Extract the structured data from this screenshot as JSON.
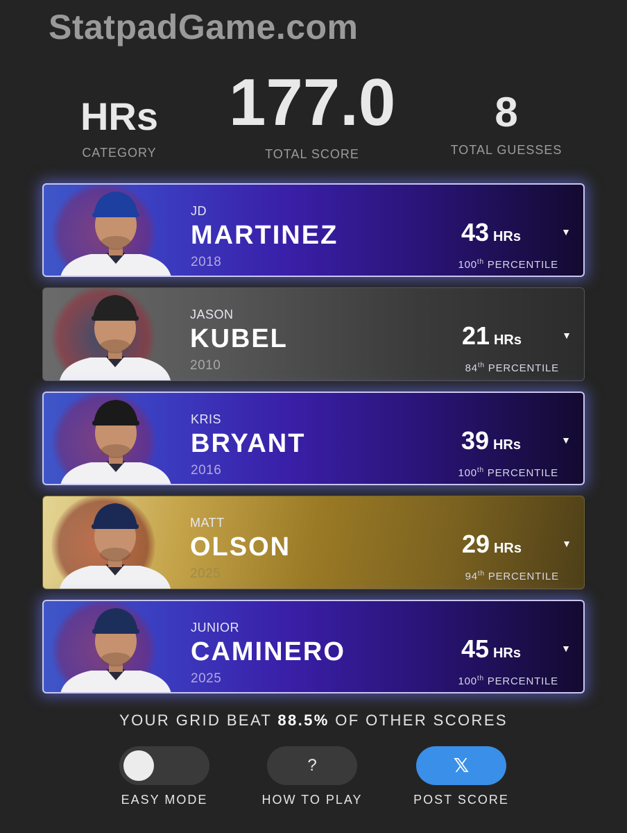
{
  "header": {
    "site_title": "StatpadGame.com"
  },
  "summary": {
    "category_value": "HRs",
    "category_label": "CATEGORY",
    "score_value": "177.0",
    "score_label": "TOTAL SCORE",
    "guesses_value": "8",
    "guesses_label": "TOTAL GUESSES"
  },
  "players": [
    {
      "first": "JD",
      "last": "MARTINEZ",
      "year": "2018",
      "hrs": "43",
      "unit": "HRs",
      "pct": "100",
      "pct_suffix": "th",
      "pct_label": "PERCENTILE",
      "style": "purple",
      "team_logo": "boston-red-sox-logo",
      "cap": "mets-cap"
    },
    {
      "first": "JASON",
      "last": "KUBEL",
      "year": "2010",
      "hrs": "21",
      "unit": "HRs",
      "pct": "84",
      "pct_suffix": "th",
      "pct_label": "PERCENTILE",
      "style": "gray",
      "team_logo": "minnesota-twins-logo",
      "cap": "orioles-cap"
    },
    {
      "first": "KRIS",
      "last": "BRYANT",
      "year": "2016",
      "hrs": "39",
      "unit": "HRs",
      "pct": "100",
      "pct_suffix": "th",
      "pct_label": "PERCENTILE",
      "style": "purple",
      "team_logo": "chicago-cubs-logo",
      "cap": "rockies-cap"
    },
    {
      "first": "MATT",
      "last": "OLSON",
      "year": "2025",
      "hrs": "29",
      "unit": "HRs",
      "pct": "94",
      "pct_suffix": "th",
      "pct_label": "PERCENTILE",
      "style": "gold",
      "team_logo": "atlanta-braves-logo",
      "cap": "braves-cap"
    },
    {
      "first": "JUNIOR",
      "last": "CAMINERO",
      "year": "2025",
      "hrs": "45",
      "unit": "HRs",
      "pct": "100",
      "pct_suffix": "th",
      "pct_label": "PERCENTILE",
      "style": "purple",
      "team_logo": "tampa-bay-rays-logo",
      "cap": "rays-cap"
    }
  ],
  "result": {
    "prefix": "YOUR GRID BEAT",
    "percent": "88.5%",
    "suffix": "OF OTHER SCORES"
  },
  "controls": {
    "easy_mode_label": "EASY MODE",
    "easy_mode_on": false,
    "how_to_play_label": "HOW TO PLAY",
    "how_to_play_glyph": "?",
    "post_score_label": "POST SCORE",
    "post_score_glyph": "𝕏"
  },
  "colors": {
    "purple_accent": "#3a1fa8",
    "gold_accent": "#c5a44a",
    "post_button": "#3a8fe8",
    "background": "#242424"
  }
}
